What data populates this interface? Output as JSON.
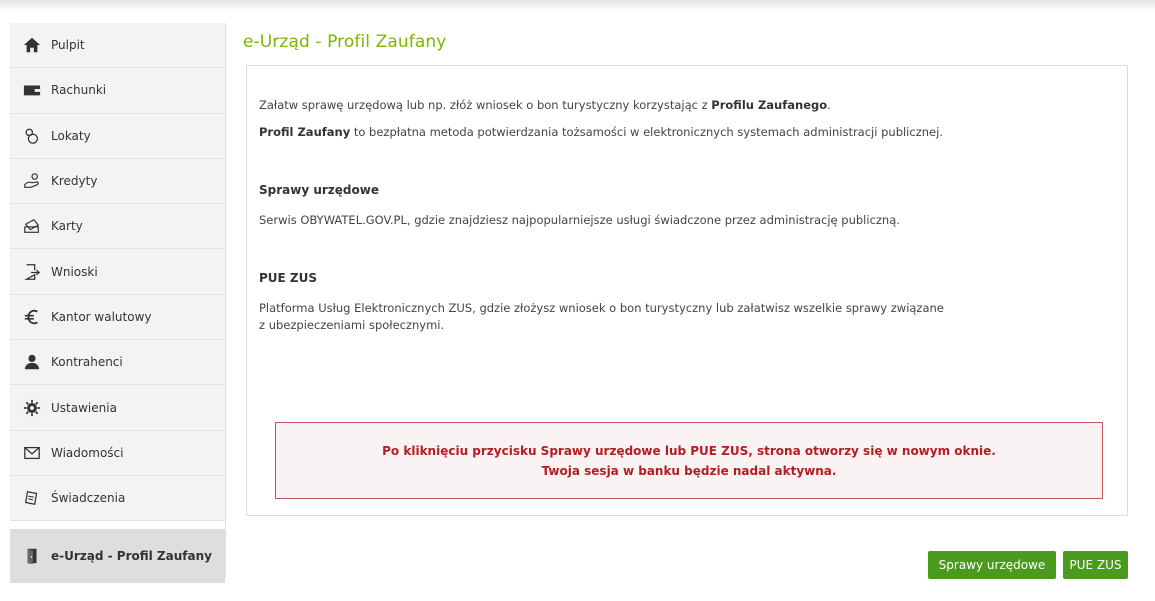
{
  "sidebar": {
    "items": [
      {
        "label": "Pulpit",
        "icon": "home-icon"
      },
      {
        "label": "Rachunki",
        "icon": "wallet-icon"
      },
      {
        "label": "Lokaty",
        "icon": "piggy-bank-icon"
      },
      {
        "label": "Kredyty",
        "icon": "hand-coins-icon"
      },
      {
        "label": "Karty",
        "icon": "cards-icon"
      },
      {
        "label": "Wnioski",
        "icon": "document-arrow-icon"
      },
      {
        "label": "Kantor walutowy",
        "icon": "euro-icon"
      },
      {
        "label": "Kontrahenci",
        "icon": "person-icon"
      },
      {
        "label": "Ustawienia",
        "icon": "gear-icon"
      },
      {
        "label": "Wiadomości",
        "icon": "envelope-icon"
      },
      {
        "label": "Świadczenia",
        "icon": "tag-icon"
      },
      {
        "label": "e-Urząd - Profil Zaufany",
        "icon": "door-icon"
      }
    ]
  },
  "main": {
    "title": "e-Urząd - Profil Zaufany",
    "intro_pre": "Załatw sprawę urzędową lub np. złóż wniosek o bon turystyczny korzystając z ",
    "intro_bold": "Profilu Zaufanego",
    "intro_post": ".",
    "pz_bold": "Profil Zaufany",
    "pz_text": " to bezpłatna metoda potwierdzania tożsamości w elektronicznych systemach administracji publicznej.",
    "section1_heading": "Sprawy urzędowe",
    "section1_text": "Serwis OBYWATEL.GOV.PL, gdzie znajdziesz najpopularniejsze usługi świadczone przez administrację publiczną.",
    "section2_heading": "PUE ZUS",
    "section2_line1": "Platforma Usług Elektronicznych ZUS, gdzie złożysz wniosek o bon turystyczny lub załatwisz wszelkie sprawy związane",
    "section2_line2": "z ubezpieczeniami społecznymi.",
    "alert_line1": "Po kliknięciu przycisku Sprawy urzędowe lub PUE ZUS, strona otworzy się w nowym oknie.",
    "alert_line2": "Twoja sesja w banku będzie nadal aktywna."
  },
  "buttons": {
    "sprawy": "Sprawy urzędowe",
    "pue": "PUE ZUS"
  },
  "colors": {
    "accent": "#7ab800",
    "button": "#4a9a1e",
    "alert_border": "#c2585b",
    "alert_text": "#b71c22"
  }
}
